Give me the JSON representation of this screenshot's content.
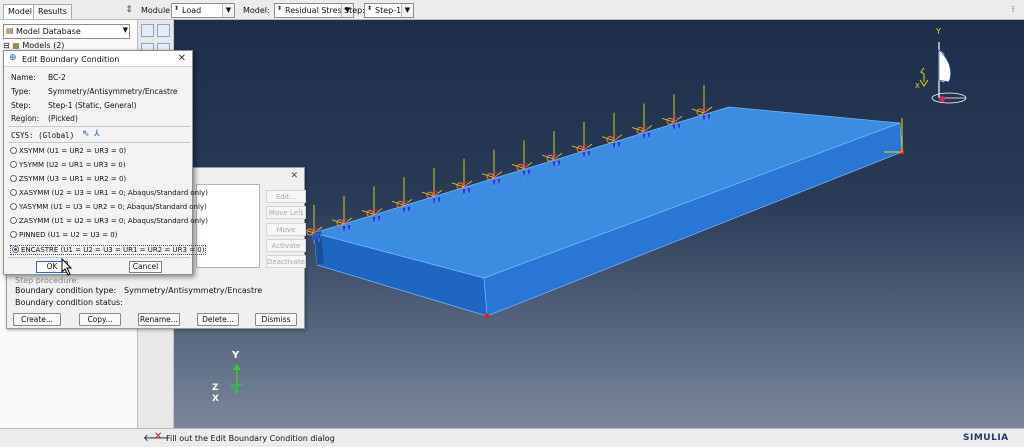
{
  "tree_tabs": [
    "Model",
    "Results"
  ],
  "toolbar": {
    "module_label": "Module:",
    "module_value": "Load",
    "model_label": "Model:",
    "model_value": "Residual Stress",
    "step_label": "Step:",
    "step_value": "Step-1"
  },
  "left_panel": {
    "database_combo": "Model Database",
    "tree_root": "Models (2)"
  },
  "edit_dialog": {
    "title": "Edit Boundary Condition",
    "name_label": "Name:",
    "name_value": "BC-2",
    "type_label": "Type:",
    "type_value": "Symmetry/Antisymmetry/Encastre",
    "step_label": "Step:",
    "step_value": "Step-1 (Static, General)",
    "region_label": "Region:",
    "region_value": "(Picked)",
    "csys_label": "CSYS: (Global)",
    "options": [
      "XSYMM (U1 = UR2 = UR3 = 0)",
      "YSYMM (U2 = UR1 = UR3 = 0)",
      "ZSYMM (U3 = UR1 = UR2 = 0)",
      "XASYMM (U2 = U3 = UR1 = 0; Abaqus/Standard only)",
      "YASYMM (U1 = U3 = UR2 = 0; Abaqus/Standard only)",
      "ZASYMM (U1 = U2 = UR3 = 0; Abaqus/Standard only)",
      "PINNED (U1 = U2 = U3 = 0)",
      "ENCASTRE (U1 = U2 = U3 = UR1 = UR2 = UR3 = 0)"
    ],
    "selected_index": 7,
    "ok_label": "OK",
    "cancel_label": "Cancel"
  },
  "bc_manager": {
    "side_buttons": [
      "Edit...",
      "Move Left",
      "Move Right",
      "Activate",
      "Deactivate"
    ],
    "step_procedure": "Step procedure:",
    "bc_type_label": "Boundary condition type:",
    "bc_type_value": "Symmetry/Antisymmetry/Encastre",
    "bc_status_label": "Boundary condition status:",
    "buttons": [
      "Create...",
      "Copy...",
      "Rename...",
      "Delete...",
      "Dismiss"
    ]
  },
  "viewport": {
    "triad_x": "X",
    "triad_y": "Y",
    "triad_z": "Z",
    "colors": {
      "part_top": "#3a8de0",
      "part_side": "#1f66c2",
      "marker": "#e02020",
      "axis": "#e8e000"
    }
  },
  "status": {
    "message": "Fill out the Edit Boundary Condition dialog",
    "brand": "SIMULIA"
  }
}
